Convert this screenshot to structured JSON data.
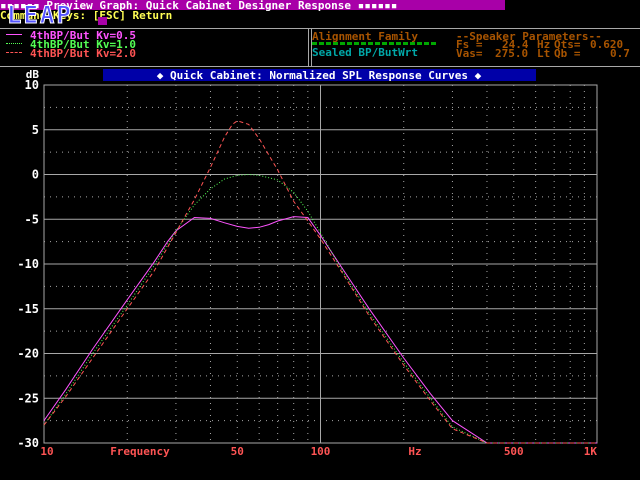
{
  "header": {
    "logo_text": "LEAP",
    "title": "Preview Graph: Quick Cabinet Designer Response",
    "title_marks": "▪▪▪▪▪▪",
    "title_marks_right": "▪▪▪▪▪▪",
    "command_keys": "Command Keys: [ESC] Return"
  },
  "info_panel": {
    "alignment_heading": "Alignment Family",
    "alignment_value": "Sealed BP/ButWrt",
    "speaker_heading": "--Speaker Parameters--",
    "fs_label": "Fs =",
    "fs_value": "24.4",
    "fs_unit": "Hz",
    "qts_label": "Qts=",
    "qts_value": "0.620",
    "vas_label": "Vas=",
    "vas_value": "275.0",
    "vas_unit": "Lt",
    "qb_label": "Qb =",
    "qb_value": "0.7"
  },
  "colors": {
    "series1": "#ff54ff",
    "series2": "#54ff54",
    "series3": "#ff5454",
    "title_bg": "#0000a8",
    "title_fg": "#ffffff",
    "axis_labels": "#ffffff",
    "x_labels": "#ff5454",
    "grid": "#a8a8a8",
    "header_bg": "#a800a8",
    "command_fg": "#ffff54",
    "alignment_fg": "#a85400",
    "sealed_fg": "#00a8a8"
  },
  "chart_data": {
    "type": "line",
    "title": "◆ Quick Cabinet: Normalized SPL Response Curves ◆",
    "xlabel": "Frequency",
    "ylabel": "dB",
    "x_unit": "Hz",
    "x_scale": "log",
    "xlim": [
      10,
      1000
    ],
    "ylim": [
      -30,
      10
    ],
    "x_ticks": [
      {
        "value": 10,
        "label": "10"
      },
      {
        "value": 50,
        "label": "50"
      },
      {
        "value": 100,
        "label": "100"
      },
      {
        "value": 500,
        "label": "500"
      },
      {
        "value": 1000,
        "label": "1K"
      }
    ],
    "y_ticks": [
      10,
      5,
      0,
      -5,
      -10,
      -15,
      -20,
      -25,
      -30
    ],
    "grid": true,
    "legend_position": "top-left",
    "series": [
      {
        "name": "4thBP/But Kv=0.5",
        "style": "solid",
        "x": [
          10,
          12,
          15,
          20,
          25,
          28,
          30,
          35,
          40,
          45,
          50,
          55,
          60,
          65,
          70,
          80,
          90,
          100,
          120,
          150,
          200,
          250,
          300,
          400,
          500,
          600,
          700,
          800,
          1000
        ],
        "y": [
          -27.5,
          -24.0,
          -19.5,
          -14.0,
          -9.8,
          -7.5,
          -6.3,
          -4.8,
          -4.9,
          -5.4,
          -5.8,
          -6.0,
          -5.9,
          -5.6,
          -5.2,
          -4.7,
          -4.8,
          -6.8,
          -10.5,
          -15.0,
          -20.5,
          -24.5,
          -27.5,
          -30,
          -30,
          -30,
          -30,
          -30,
          -30
        ]
      },
      {
        "name": "4thBP/But Kv=1.0",
        "style": "dotted",
        "x": [
          10,
          12,
          15,
          20,
          25,
          30,
          35,
          40,
          45,
          50,
          55,
          60,
          70,
          80,
          90,
          100,
          120,
          150,
          200,
          250,
          300,
          400,
          500,
          600,
          800,
          1000
        ],
        "y": [
          -28.0,
          -24.5,
          -20.0,
          -14.6,
          -10.2,
          -6.3,
          -3.4,
          -1.6,
          -0.5,
          -0.1,
          0.0,
          -0.1,
          -0.6,
          -2.0,
          -4.1,
          -6.5,
          -10.8,
          -15.5,
          -21.0,
          -25.0,
          -28.2,
          -30,
          -30,
          -30,
          -30,
          -30
        ]
      },
      {
        "name": "4thBP/But Kv=2.0",
        "style": "dashed",
        "x": [
          10,
          12,
          15,
          20,
          25,
          30,
          35,
          40,
          45,
          48,
          50,
          55,
          60,
          70,
          80,
          90,
          100,
          120,
          150,
          200,
          250,
          300,
          400,
          500,
          600,
          800,
          1000
        ],
        "y": [
          -28.0,
          -24.8,
          -20.5,
          -15.0,
          -10.8,
          -6.5,
          -2.8,
          0.8,
          4.2,
          5.6,
          6.0,
          5.6,
          4.0,
          0.5,
          -3.0,
          -5.2,
          -7.2,
          -11.0,
          -15.8,
          -21.3,
          -25.3,
          -28.4,
          -30,
          -30,
          -30,
          -30,
          -30
        ]
      }
    ]
  }
}
